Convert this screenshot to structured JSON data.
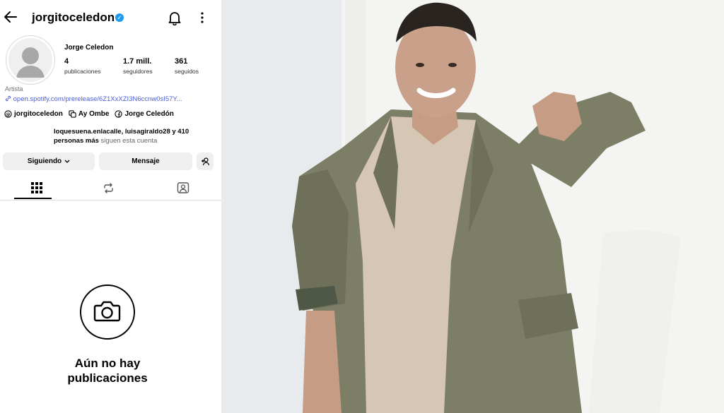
{
  "profile": {
    "username": "jorgitoceledon",
    "name": "Jorge Celedon",
    "stats": [
      {
        "value": "4",
        "label": "publicaciones"
      },
      {
        "value": "1.7 mill.",
        "label": "seguidores"
      },
      {
        "value": "361",
        "label": "seguidos"
      }
    ],
    "category": "Artista",
    "link": "open.spotify.com/prerelease/6Z1XxXZI3N6ccnw0sI57Y...",
    "handles": [
      {
        "icon": "threads-icon",
        "label": "jorgitoceledon"
      },
      {
        "icon": "copy-icon",
        "label": "Ay Ombe"
      },
      {
        "icon": "facebook-icon",
        "label": "Jorge Celedón"
      }
    ],
    "followed_by": {
      "line1": "loquesuena.enlacalle, luisagiraldo28 y 410",
      "line2_bold": "personas más",
      "line2_rest": " siguen esta cuenta"
    },
    "buttons": {
      "following": "Siguiendo",
      "message": "Mensaje"
    },
    "empty_state": {
      "line1": "Aún no hay",
      "line2": "publicaciones"
    }
  },
  "colors": {
    "verified": "#1d9bf0",
    "link": "#4a5dd8",
    "button_bg": "#efefef"
  }
}
